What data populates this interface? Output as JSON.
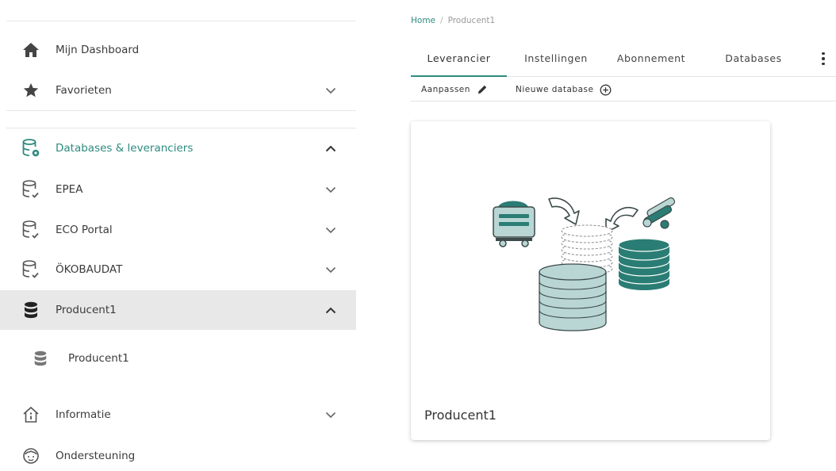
{
  "sidebar": {
    "items": [
      {
        "label": "Mijn Dashboard",
        "icon": "home-icon"
      },
      {
        "label": "Favorieten",
        "icon": "star-icon"
      },
      {
        "label": "Databases & leveranciers",
        "icon": "database-settings-icon",
        "expanded": true
      },
      {
        "label": "EPEA",
        "icon": "database-check-icon"
      },
      {
        "label": "ECO Portal",
        "icon": "database-check-icon"
      },
      {
        "label": "ÖKOBAUDAT",
        "icon": "database-check-icon"
      },
      {
        "label": "Producent1",
        "icon": "database-icon",
        "expanded": true,
        "selected": true
      },
      {
        "label": "Producent1",
        "icon": "database-icon"
      },
      {
        "label": "Informatie",
        "icon": "info-house-icon"
      },
      {
        "label": "Ondersteuning",
        "icon": "support-face-icon"
      }
    ]
  },
  "breadcrumb": {
    "home": "Home",
    "separator": "/",
    "current": "Producent1"
  },
  "tabs": [
    {
      "label": "Leverancier",
      "active": true
    },
    {
      "label": "Instellingen"
    },
    {
      "label": "Abonnement"
    },
    {
      "label": "Databases"
    }
  ],
  "toolbar": {
    "edit_label": "Aanpassen",
    "new_db_label": "Nieuwe database"
  },
  "card": {
    "title": "Producent1"
  },
  "colors": {
    "accent": "#2e8b80",
    "illustration_light": "#b9d6d4",
    "illustration_dark": "#2a7d74"
  }
}
